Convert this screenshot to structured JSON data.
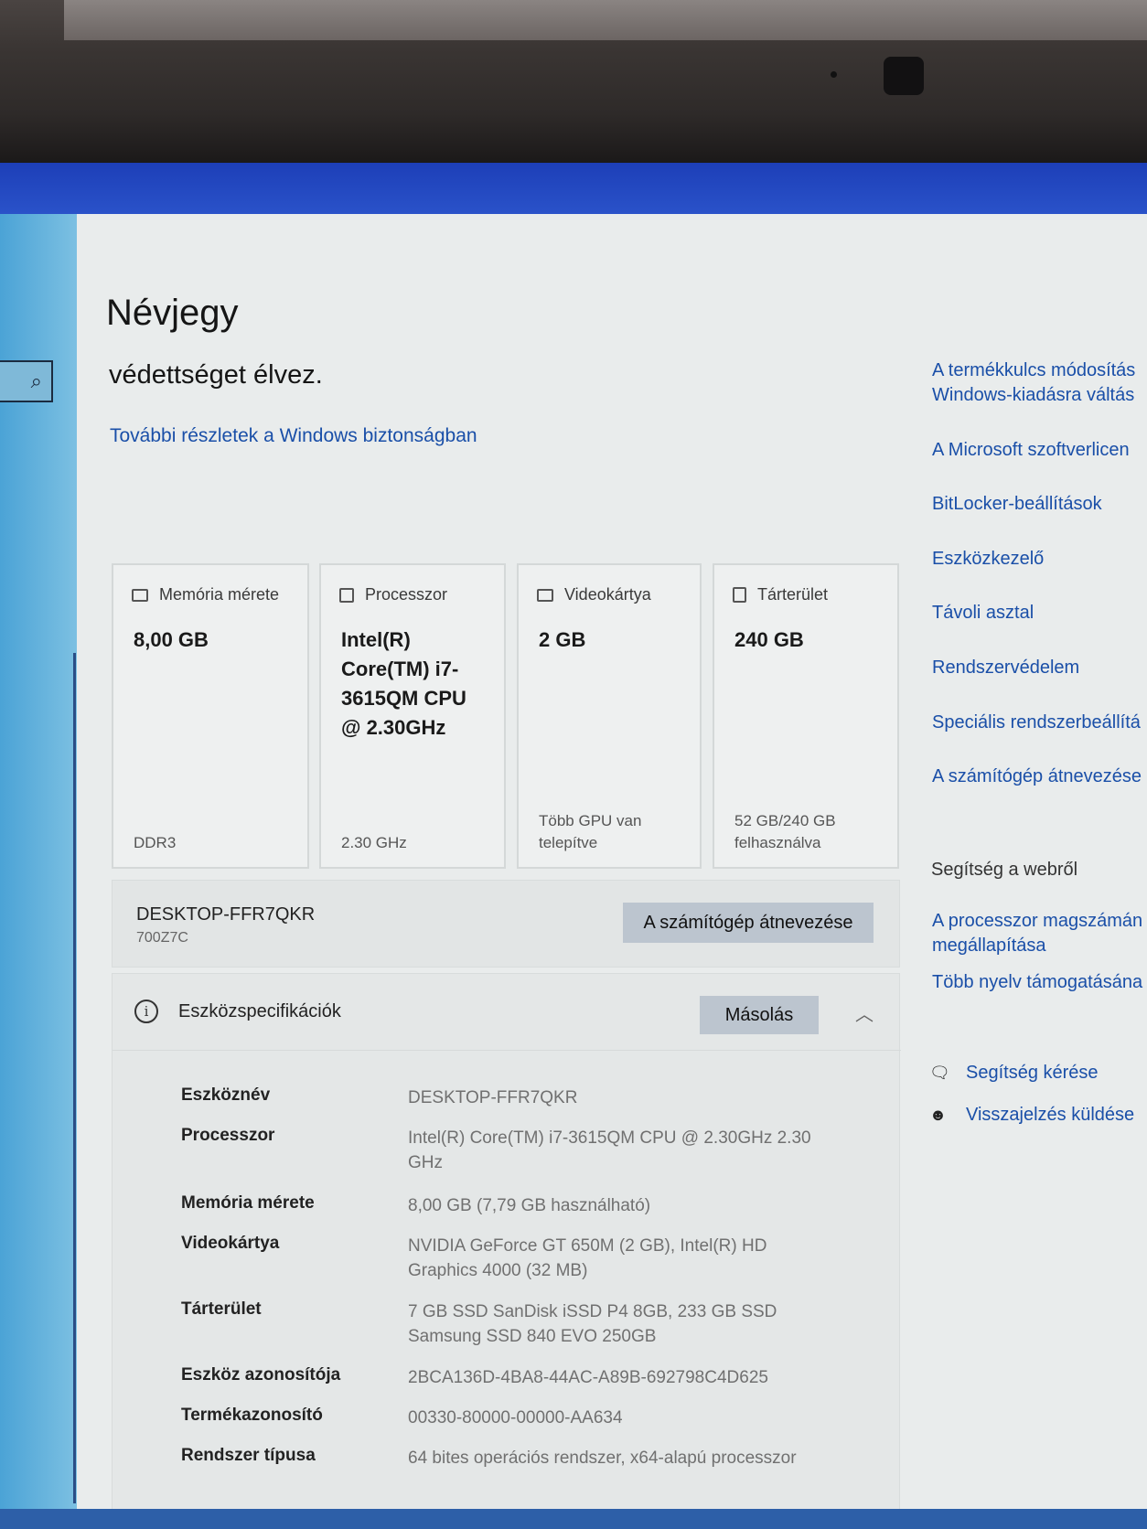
{
  "page": {
    "title": "Névjegy",
    "protection_text": "védettséget élvez.",
    "security_link": "További részletek a Windows biztonságban"
  },
  "cards": [
    {
      "icon": "memory-icon",
      "label": "Memória mérete",
      "value": "8,00 GB",
      "footer": "DDR3"
    },
    {
      "icon": "processor-icon",
      "label": "Processzor",
      "value": "Intel(R) Core(TM) i7-3615QM CPU @ 2.30GHz",
      "footer": "2.30 GHz"
    },
    {
      "icon": "gpu-icon",
      "label": "Videokártya",
      "value": "2 GB",
      "footer": "Több GPU van telepítve"
    },
    {
      "icon": "storage-icon",
      "label": "Tárterület",
      "value": "240 GB",
      "footer": "52 GB/240 GB felhasználva"
    }
  ],
  "device": {
    "name": "DESKTOP-FFR7QKR",
    "model": "700Z7C",
    "rename_button": "A számítógép átnevezése"
  },
  "specs": {
    "title": "Eszközspecifikációk",
    "copy_button": "Másolás",
    "rows": [
      {
        "key": "Eszköznév",
        "value": "DESKTOP-FFR7QKR"
      },
      {
        "key": "Processzor",
        "value": "Intel(R) Core(TM) i7-3615QM CPU @ 2.30GHz 2.30 GHz"
      },
      {
        "key": "Memória mérete",
        "value": "8,00 GB (7,79 GB használható)"
      },
      {
        "key": "Videokártya",
        "value": "NVIDIA GeForce GT 650M (2 GB), Intel(R) HD Graphics 4000 (32 MB)"
      },
      {
        "key": "Tárterület",
        "value": "7 GB SSD SanDisk iSSD P4 8GB, 233 GB SSD Samsung SSD 840 EVO 250GB"
      },
      {
        "key": "Eszköz azonosítója",
        "value": "2BCA136D-4BA8-44AC-A89B-692798C4D625"
      },
      {
        "key": "Termékazonosító",
        "value": "00330-80000-00000-AA634"
      },
      {
        "key": "Rendszer típusa",
        "value": "64 bites operációs rendszer, x64-alapú processzor"
      }
    ]
  },
  "related": {
    "links": [
      "A termékkulcs módosítás",
      "Windows-kiadásra váltás",
      "A Microsoft szoftverlicen",
      "BitLocker-beállítások",
      "Eszközkezelő",
      "Távoli asztal",
      "Rendszervédelem",
      "Speciális rendszerbeállítá",
      "A számítógép átnevezése"
    ],
    "web_help_title": "Segítség a webről",
    "web_help_links": [
      "A processzor magszámán",
      "megállapítása",
      "Több nyelv támogatásána"
    ],
    "help": [
      {
        "icon": "help-chat-icon",
        "label": "Segítség kérése"
      },
      {
        "icon": "feedback-icon",
        "label": "Visszajelzés küldése"
      }
    ]
  },
  "colors": {
    "link": "#1a4fa8",
    "titlebar": "#1d3fb8",
    "button": "#bcc5cf"
  }
}
